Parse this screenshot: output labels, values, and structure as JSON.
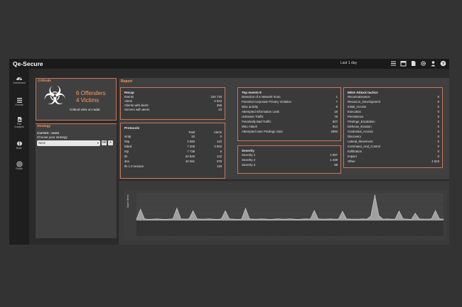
{
  "app": {
    "title": "Qe-Secure",
    "time_range": "Last 1 day"
  },
  "top_icons": [
    "list-icon",
    "calendar-icon",
    "document-icon",
    "gear-icon",
    "user-icon",
    "help-icon"
  ],
  "sidebar": {
    "items": [
      {
        "label": "Dashboard",
        "icon": "dashboard-icon"
      },
      {
        "label": "Events",
        "icon": "events-icon"
      },
      {
        "label": "File Analysis",
        "icon": "file-analysis-icon"
      },
      {
        "label": "Brain",
        "icon": "brain-icon"
      },
      {
        "label": "Radar",
        "icon": "radar-icon"
      }
    ]
  },
  "criticals": {
    "title": "Criticals",
    "offenders": "6 Offenders",
    "victims": "4 Victims",
    "link": "Critical view on radar"
  },
  "strategy": {
    "title": "Strategy",
    "current": "Current : none",
    "prompt": "Choose your strategy",
    "selected": "None",
    "ok_label": "ok",
    "add_label": "+"
  },
  "report": {
    "title": "Report",
    "recap": {
      "title": "Recap",
      "rows": [
        {
          "label": "Events",
          "value": "234 718"
        },
        {
          "label": "Alerts",
          "value": "4 523"
        },
        {
          "label": "Clients with alerts",
          "value": "256"
        },
        {
          "label": "Servers with alerts",
          "value": "23"
        }
      ]
    },
    "protocols": {
      "title": "Protocols",
      "col_total": "Total",
      "col_alerts": "Alerts",
      "rows": [
        {
          "label": "smtp",
          "total": "20",
          "alerts": "0"
        },
        {
          "label": "http",
          "total": "3 585",
          "alerts": "110"
        },
        {
          "label": "failed",
          "total": "7 206",
          "alerts": "3 902"
        },
        {
          "label": "ntp",
          "total": "7 738",
          "alerts": "5"
        },
        {
          "label": "tls",
          "total": "22 826",
          "alerts": "122"
        },
        {
          "label": "dns",
          "total": "40 691",
          "alerts": "378"
        },
        {
          "label": "tls 1.0 session",
          "total": "",
          "alerts": "118"
        }
      ]
    },
    "top_events": {
      "title": "Top events 8",
      "rows": [
        {
          "label": "Detection of a Network Scan",
          "value": "1"
        },
        {
          "label": "Potential Corporate Privacy Violation",
          "value": "7"
        },
        {
          "label": "Misc activity",
          "value": "9"
        },
        {
          "label": "Attempted Information Leak",
          "value": "18"
        },
        {
          "label": "Unknown Traffic",
          "value": "78"
        },
        {
          "label": "Potentially Bad Traffic",
          "value": "507"
        },
        {
          "label": "Misc Attack",
          "value": "913"
        },
        {
          "label": "Attempted User Privilege Gain",
          "value": "2990"
        }
      ]
    },
    "severity": {
      "title": "Severity",
      "rows": [
        {
          "label": "Severity 1",
          "value": "2 997"
        },
        {
          "label": "Severity 2",
          "value": "1 438"
        },
        {
          "label": "Severity 3",
          "value": "98"
        }
      ]
    },
    "mitre": {
      "title": "Mitre Att&ck tactics",
      "rows": [
        {
          "label": "Reconnaissance",
          "value": "0"
        },
        {
          "label": "Resource_Development",
          "value": "0"
        },
        {
          "label": "Initial_Access",
          "value": "0"
        },
        {
          "label": "Execution",
          "value": "0"
        },
        {
          "label": "Persistence",
          "value": "0"
        },
        {
          "label": "Privilege_Escalation",
          "value": "0"
        },
        {
          "label": "Defense_Evasion",
          "value": "0"
        },
        {
          "label": "Credential_Access",
          "value": "0"
        },
        {
          "label": "Discovery",
          "value": "0"
        },
        {
          "label": "Lateral_Movement",
          "value": "0"
        },
        {
          "label": "Command_And_Control",
          "value": "0"
        },
        {
          "label": "Exfiltration",
          "value": "0"
        },
        {
          "label": "Impact",
          "value": "0"
        },
        {
          "label": "Other",
          "value": "4 523"
        }
      ]
    }
  },
  "chart_data": {
    "type": "area",
    "title": "",
    "ylabel": "Open Items",
    "xlabel": "",
    "ylim": [
      0,
      1
    ],
    "values": [
      0.05,
      0.42,
      0.06,
      0.04,
      0.05,
      0.06,
      0.05,
      0.04,
      0.05,
      0.06,
      0.46,
      0.06,
      0.05,
      0.06,
      0.36,
      0.06,
      0.05,
      0.05,
      0.06,
      0.05,
      0.04,
      0.06,
      0.36,
      0.06,
      0.05,
      0.04,
      0.05,
      0.45,
      0.06,
      0.05,
      0.05,
      0.06,
      0.05,
      0.04,
      0.05,
      0.06,
      0.05,
      0.05,
      0.06,
      0.05,
      0.04,
      0.05,
      0.06,
      0.05,
      0.37,
      0.06,
      0.05,
      0.05,
      0.06,
      0.05,
      0.05,
      0.34,
      0.06,
      0.05,
      0.05,
      0.05,
      0.06,
      0.05,
      0.16,
      0.95,
      0.18,
      0.05,
      0.06,
      0.05,
      0.05,
      0.35,
      0.06,
      0.05,
      0.04,
      0.27,
      0.06,
      0.05,
      0.05,
      0.06,
      0.37,
      0.06,
      0.05
    ],
    "color": "#a0a0a0",
    "grid": true
  }
}
